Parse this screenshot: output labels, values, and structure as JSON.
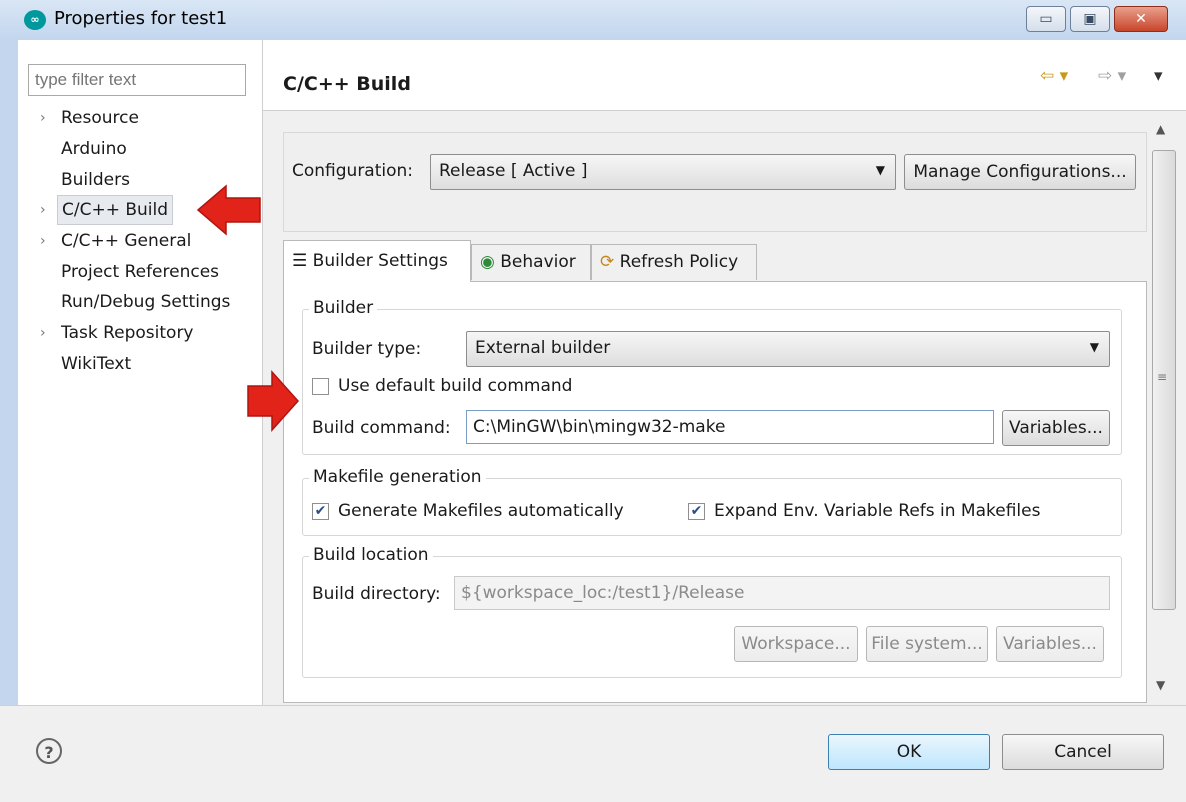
{
  "window": {
    "title": "Properties for test1",
    "app_icon": "arduino-icon",
    "controls": {
      "minimize": "▭",
      "maximize": "▣",
      "close": "✕"
    }
  },
  "sidebar": {
    "filter_placeholder": "type filter text",
    "items": [
      {
        "label": "Resource",
        "expandable": true
      },
      {
        "label": "Arduino",
        "expandable": false
      },
      {
        "label": "Builders",
        "expandable": false
      },
      {
        "label": "C/C++ Build",
        "expandable": true,
        "selected": true
      },
      {
        "label": "C/C++ General",
        "expandable": true
      },
      {
        "label": "Project References",
        "expandable": false
      },
      {
        "label": "Run/Debug Settings",
        "expandable": false
      },
      {
        "label": "Task Repository",
        "expandable": true
      },
      {
        "label": "WikiText",
        "expandable": false
      }
    ]
  },
  "header": {
    "title": "C/C++ Build",
    "back_icon": "⇦ ▾",
    "forward_icon": "⇨ ▾",
    "menu_icon": "▾"
  },
  "configuration": {
    "label": "Configuration:",
    "value": "Release  [ Active ]",
    "manage_button": "Manage Configurations..."
  },
  "tabs": [
    {
      "label": "Builder Settings",
      "icon": "list-icon",
      "selected": true
    },
    {
      "label": "Behavior",
      "icon": "radio-icon"
    },
    {
      "label": "Refresh Policy",
      "icon": "refresh-icon"
    }
  ],
  "builder": {
    "group_title": "Builder",
    "type_label": "Builder type:",
    "type_value": "External builder",
    "use_default_label": "Use default build command",
    "use_default_checked": false,
    "command_label": "Build command:",
    "command_value": "C:\\MinGW\\bin\\mingw32-make",
    "variables_button": "Variables..."
  },
  "makefile": {
    "group_title": "Makefile generation",
    "generate_label": "Generate Makefiles automatically",
    "generate_checked": true,
    "expand_label": "Expand Env. Variable Refs in Makefiles",
    "expand_checked": true
  },
  "location": {
    "group_title": "Build location",
    "directory_label": "Build directory:",
    "directory_value": "${workspace_loc:/test1}/Release",
    "workspace_button": "Workspace...",
    "filesystem_button": "File system...",
    "variables_button": "Variables..."
  },
  "footer": {
    "help": "?",
    "ok": "OK",
    "cancel": "Cancel"
  },
  "colors": {
    "accent_arrow": "#e2231a",
    "title_bar": "#c3d6ee",
    "selection": "#e7ebef"
  }
}
